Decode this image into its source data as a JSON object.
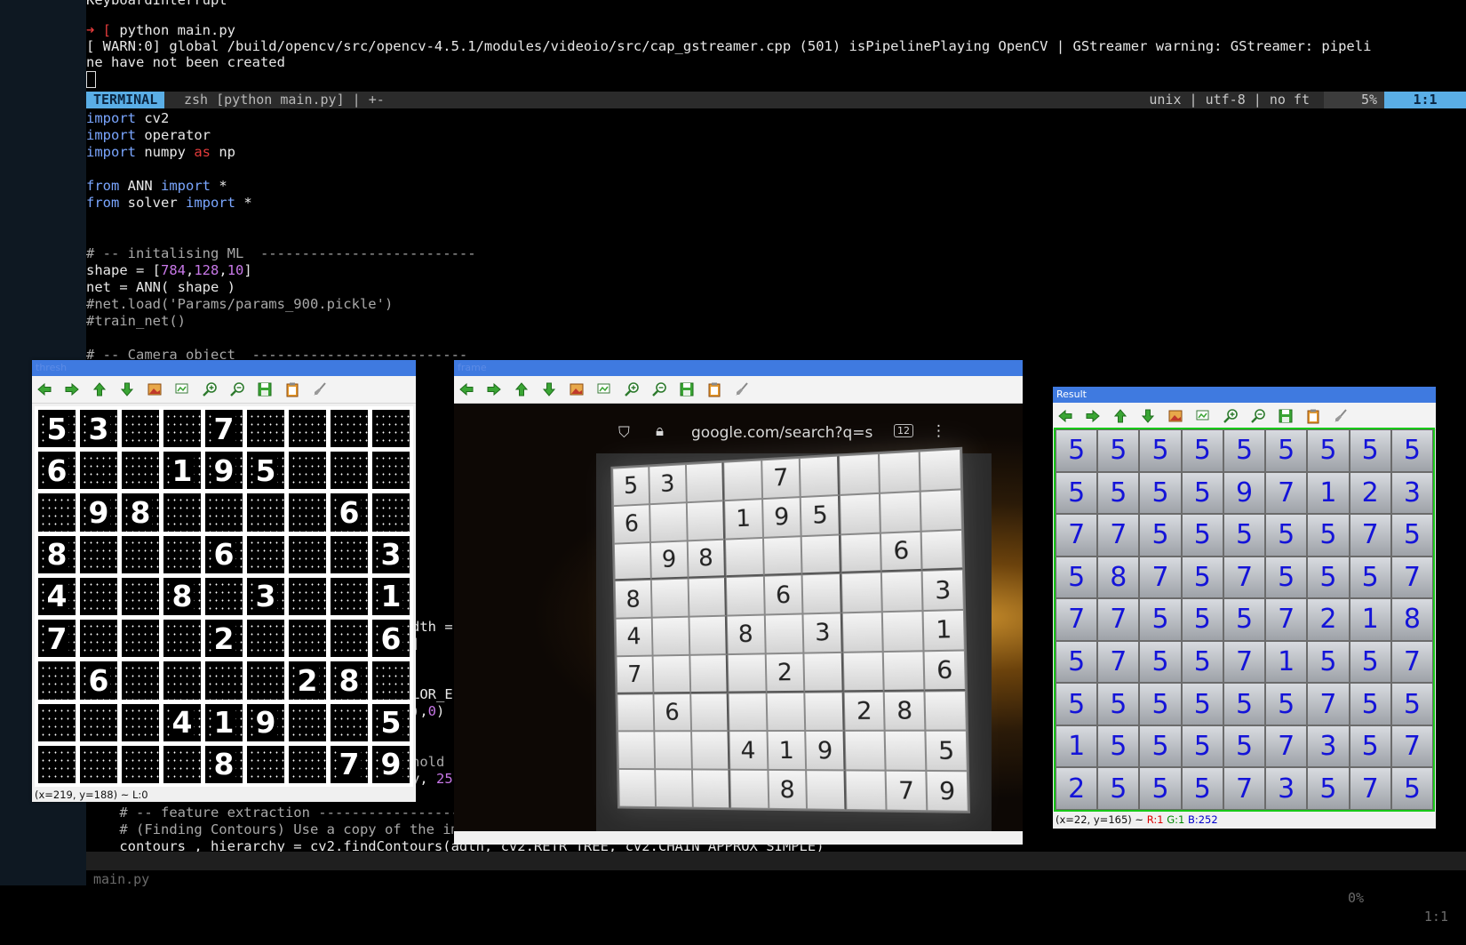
{
  "terminal": {
    "top_lines": [
      {
        "text": "KeyboardInterrupt"
      },
      {
        "text": ""
      },
      {
        "prompt": "➜ [",
        "text": " python main.py"
      },
      {
        "text": "[ WARN:0] global /build/opencv/src/opencv-4.5.1/modules/videoio/src/cap_gstreamer.cpp (501) isPipelinePlaying OpenCV | GStreamer warning: GStreamer: pipeli"
      },
      {
        "text": "ne have not been created"
      }
    ],
    "statusline": {
      "mode": "TERMINAL",
      "name": "zsh [python main.py] | +-",
      "format": "unix | utf-8 | no ft",
      "percent": "5%",
      "position": "1:1"
    },
    "code": {
      "import": "import",
      "from": "from",
      "as": "as",
      "mod_cv2": " cv2",
      "mod_operator": " operator",
      "mod_numpy": " numpy ",
      "alias_np": " np",
      "mod_ann": " ANN ",
      "mod_solver": " solver ",
      "star": " *",
      "comment_ml": "# -- initalising ML  --------------------------",
      "shape_pre": "shape = [",
      "n784": "784",
      "comma": ",",
      "n128": "128",
      "n10": "10",
      "close_br": "]",
      "net_line": "net = ANN( shape )",
      "comment_load": "#net.load('Params/params_900.pickle')",
      "comment_train": "#train_net()",
      "comment_cam": "# -- Camera object  --------------------------",
      "frag_dth": "dth =",
      "frag_bracket": "]",
      "frag_lor": "LOR_E",
      "frag_paren": "),",
      "frag_zero": "0",
      "frag_paren2": ")",
      "frag_hold": "hold",
      "frag_y": "y, ",
      "frag_25": "25",
      "comment_feat": "    # -- feature extraction -----------------------------------------------",
      "comment_find": "    # (Finding Contours) Use a copy of the image",
      "contours_line": "    contours_, hierarchy = cv2.findContours(adth, cv2.RETR_TREE, cv2.CHAIN_APPROX_SIMPLE)"
    },
    "bottom": {
      "file": "main.py",
      "percent": "0%",
      "position": "1:1"
    }
  },
  "windows": {
    "thresh": {
      "title": "thresh",
      "status": "(x=219, y=188) ~ L:0",
      "grid": [
        [
          "5",
          "3",
          "",
          "",
          "7",
          "",
          "",
          "",
          ""
        ],
        [
          "6",
          "",
          "",
          "1",
          "9",
          "5",
          "",
          "",
          ""
        ],
        [
          "",
          "9",
          "8",
          "",
          "",
          "",
          "",
          "6",
          ""
        ],
        [
          "8",
          "",
          "",
          "",
          "6",
          "",
          "",
          "",
          "3"
        ],
        [
          "4",
          "",
          "",
          "8",
          "",
          "3",
          "",
          "",
          "1"
        ],
        [
          "7",
          "",
          "",
          "",
          "2",
          "",
          "",
          "",
          "6"
        ],
        [
          "",
          "6",
          "",
          "",
          "",
          "",
          "2",
          "8",
          ""
        ],
        [
          "",
          "",
          "",
          "4",
          "1",
          "9",
          "",
          "",
          "5"
        ],
        [
          "",
          "",
          "",
          "",
          "8",
          "",
          "",
          "7",
          "9"
        ]
      ]
    },
    "frame": {
      "title": "frame",
      "url": "google.com/search?q=s",
      "tab_count": "12",
      "grid": [
        [
          "5",
          "3",
          "",
          "",
          "7",
          "",
          "",
          "",
          ""
        ],
        [
          "6",
          "",
          "",
          "1",
          "9",
          "5",
          "",
          "",
          ""
        ],
        [
          "",
          "9",
          "8",
          "",
          "",
          "",
          "",
          "6",
          ""
        ],
        [
          "8",
          "",
          "",
          "",
          "6",
          "",
          "",
          "",
          "3"
        ],
        [
          "4",
          "",
          "",
          "8",
          "",
          "3",
          "",
          "",
          "1"
        ],
        [
          "7",
          "",
          "",
          "",
          "2",
          "",
          "",
          "",
          "6"
        ],
        [
          "",
          "6",
          "",
          "",
          "",
          "",
          "2",
          "8",
          ""
        ],
        [
          "",
          "",
          "",
          "4",
          "1",
          "9",
          "",
          "",
          "5"
        ],
        [
          "",
          "",
          "",
          "",
          "8",
          "",
          "",
          "7",
          "9"
        ]
      ]
    },
    "result": {
      "title": "Result",
      "status_prefix": "(x=22, y=165) ~ ",
      "status_r": "R:1",
      "status_g": "G:1",
      "status_b": "B:252",
      "grid": [
        [
          "5",
          "5",
          "5",
          "5",
          "5",
          "5",
          "5",
          "5",
          "5"
        ],
        [
          "5",
          "5",
          "5",
          "5",
          "9",
          "7",
          "1",
          "2",
          "3"
        ],
        [
          "7",
          "7",
          "5",
          "5",
          "5",
          "5",
          "5",
          "7",
          "5"
        ],
        [
          "5",
          "8",
          "7",
          "5",
          "7",
          "5",
          "5",
          "5",
          "7"
        ],
        [
          "7",
          "7",
          "5",
          "5",
          "5",
          "7",
          "2",
          "1",
          "8"
        ],
        [
          "5",
          "7",
          "5",
          "5",
          "7",
          "1",
          "5",
          "5",
          "7"
        ],
        [
          "5",
          "5",
          "5",
          "5",
          "5",
          "5",
          "7",
          "5",
          "5"
        ],
        [
          "1",
          "5",
          "5",
          "5",
          "5",
          "7",
          "3",
          "5",
          "7"
        ],
        [
          "2",
          "5",
          "5",
          "5",
          "7",
          "3",
          "5",
          "7",
          "5"
        ]
      ]
    },
    "toolbar_icons": [
      "arrow-left-icon",
      "arrow-right-icon",
      "arrow-up-icon",
      "arrow-down-icon",
      "image-icon",
      "zoom-region-icon",
      "zoom-in-icon",
      "zoom-out-icon",
      "save-icon",
      "clipboard-icon",
      "brush-icon"
    ]
  },
  "colors": {
    "keyword": "#7aa6ff",
    "accent": "#5aaee6",
    "number": "#c878e8",
    "result_digit": "#1414d8"
  }
}
